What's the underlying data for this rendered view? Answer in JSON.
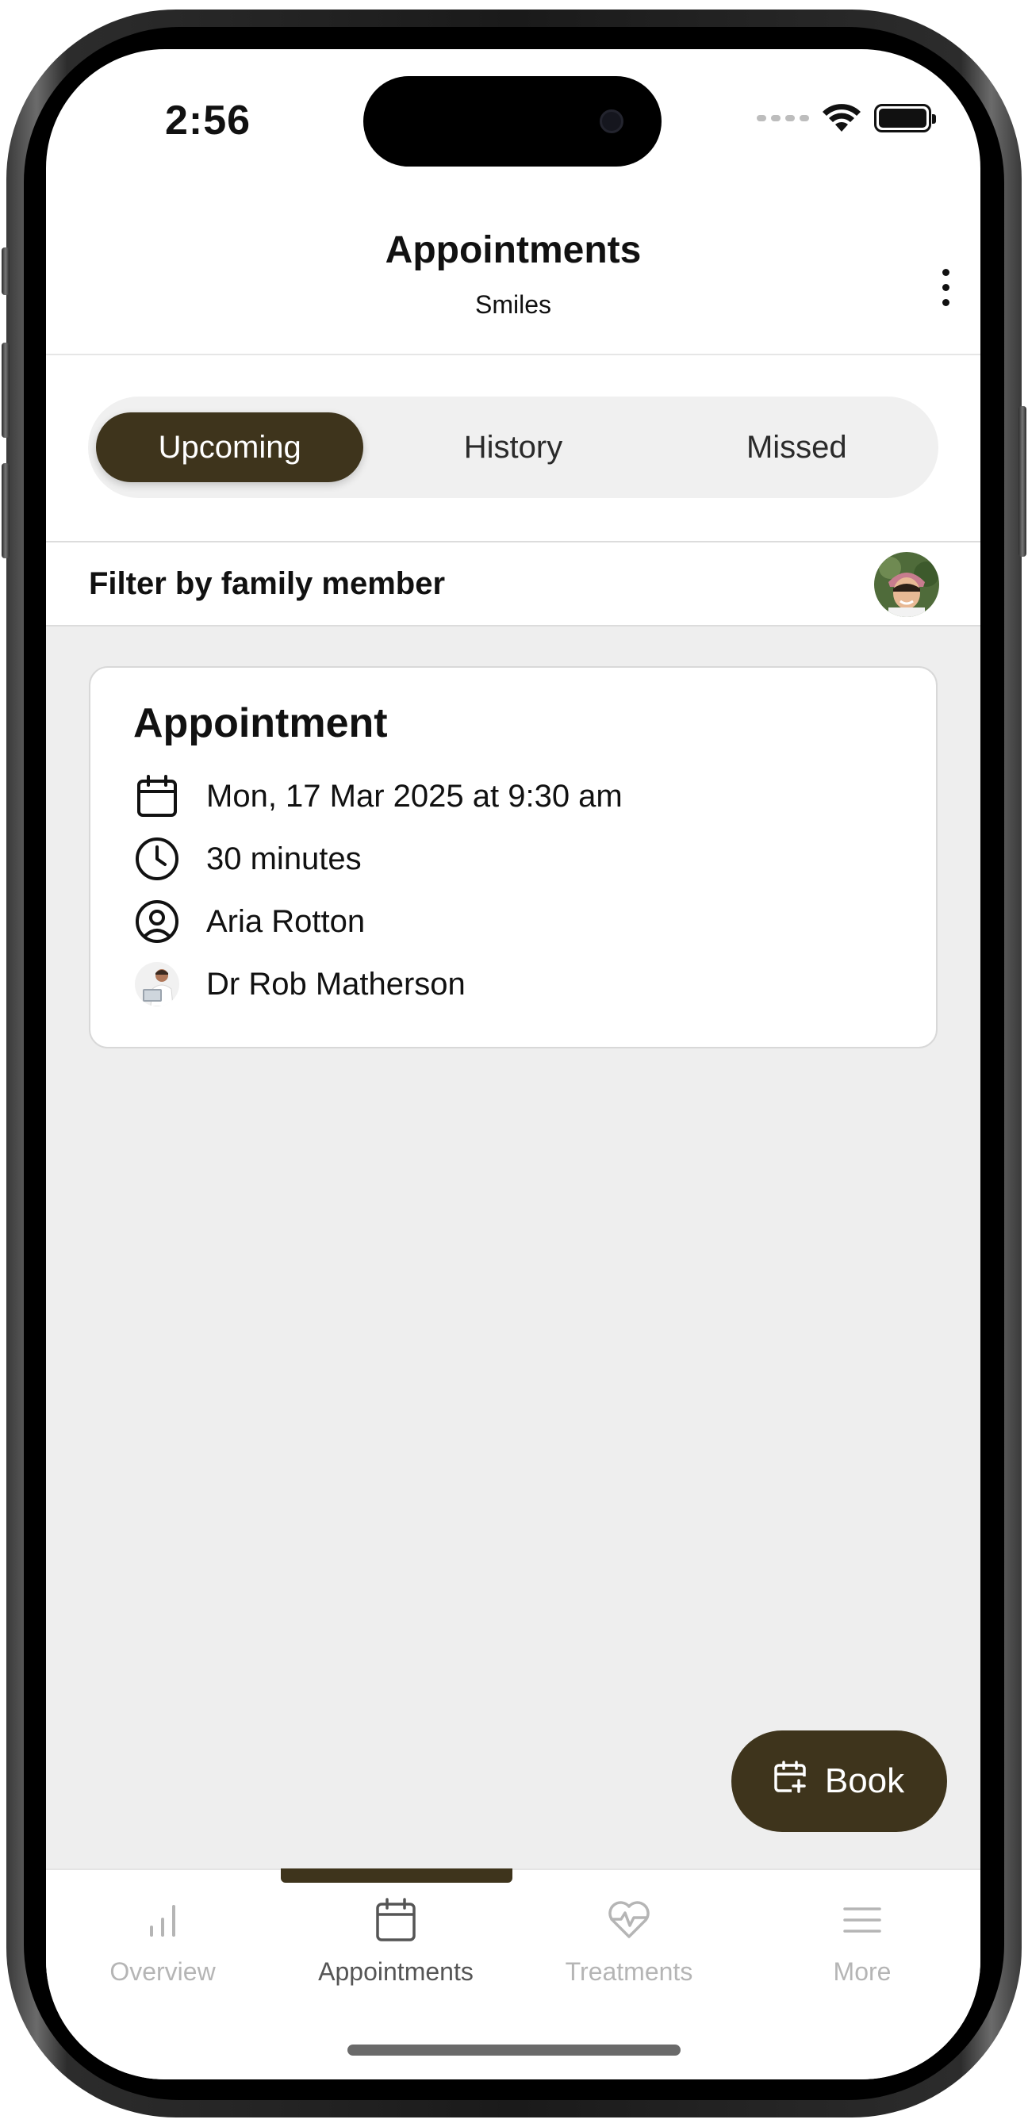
{
  "status_bar": {
    "time": "2:56"
  },
  "header": {
    "title": "Appointments",
    "subtitle": "Smiles",
    "menu_icon": "more-vertical-icon"
  },
  "segments": {
    "items": [
      {
        "label": "Upcoming",
        "active": true
      },
      {
        "label": "History",
        "active": false
      },
      {
        "label": "Missed",
        "active": false
      }
    ]
  },
  "filter": {
    "label": "Filter by family member",
    "avatar_icon": "family-member-avatar"
  },
  "appointment_card": {
    "title": "Appointment",
    "datetime": "Mon, 17 Mar 2025 at 9:30 am",
    "duration": "30 minutes",
    "patient": "Aria Rotton",
    "dentist": "Dr Rob Matherson"
  },
  "fab": {
    "label": "Book",
    "icon": "calendar-plus-icon"
  },
  "tabbar": {
    "items": [
      {
        "label": "Overview",
        "icon": "bar-chart-icon",
        "active": false
      },
      {
        "label": "Appointments",
        "icon": "calendar-icon",
        "active": true
      },
      {
        "label": "Treatments",
        "icon": "heart-pulse-icon",
        "active": false
      },
      {
        "label": "More",
        "icon": "menu-icon",
        "active": false
      }
    ]
  },
  "colors": {
    "accent": "#3e341c",
    "content_background": "#eeeeee",
    "inactive_tab": "#b5b5b5"
  }
}
